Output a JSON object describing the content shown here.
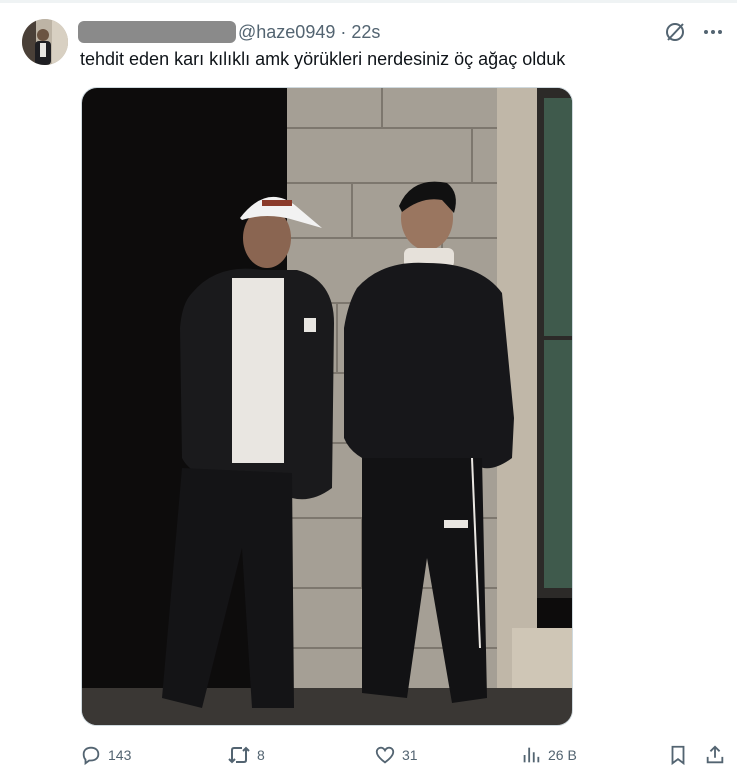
{
  "tweet": {
    "handle": "@haze0949",
    "separator": "·",
    "time": "22s",
    "text": "tehdit eden karı kılıklı amk yörükleri nerdesiniz öç ağaç olduk"
  },
  "header_icons": [
    "grok-icon",
    "more-icon"
  ],
  "actions": {
    "replies": "143",
    "retweets": "8",
    "likes": "31",
    "views": "26 B"
  },
  "colors": {
    "text": "#0f1419",
    "secondary": "#536471",
    "border": "#cfd9de",
    "redaction": "#8a8a8a"
  }
}
